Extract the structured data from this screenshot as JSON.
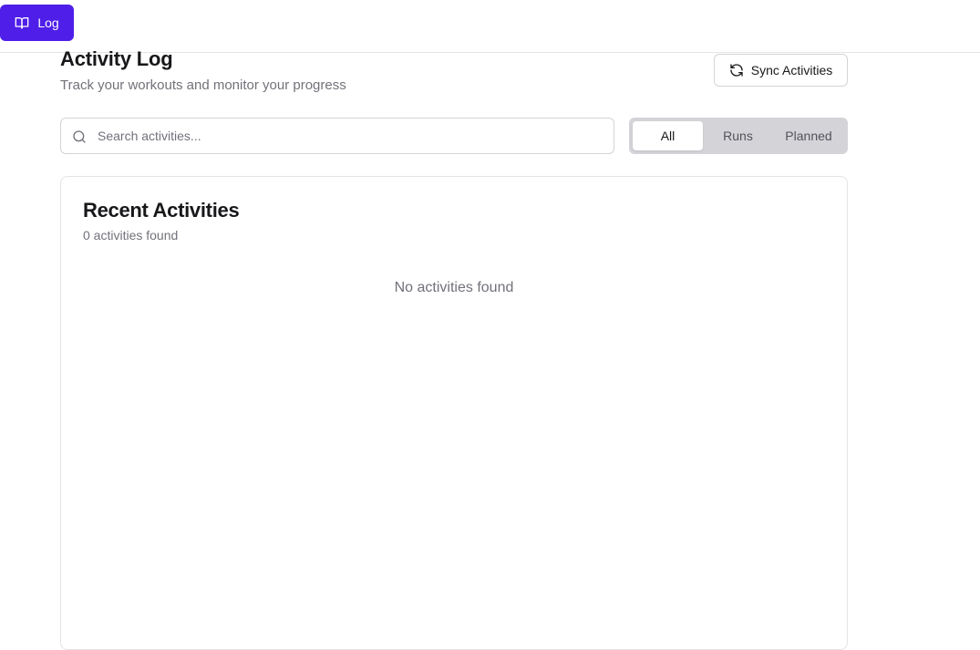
{
  "nav": {
    "log_label": "Log",
    "log_icon": "book-open-icon",
    "accent_color": "#4f1ee8"
  },
  "header": {
    "title": "Activity Log",
    "subtitle": "Track your workouts and monitor your progress",
    "sync_label": "Sync Activities",
    "sync_icon": "refresh-icon"
  },
  "search": {
    "placeholder": "Search activities...",
    "value": "",
    "icon": "search-icon"
  },
  "filters": {
    "tabs": [
      {
        "label": "All",
        "active": true
      },
      {
        "label": "Runs",
        "active": false
      },
      {
        "label": "Planned",
        "active": false
      }
    ]
  },
  "recent": {
    "title": "Recent Activities",
    "count_text": "0 activities found",
    "empty_text": "No activities found"
  }
}
